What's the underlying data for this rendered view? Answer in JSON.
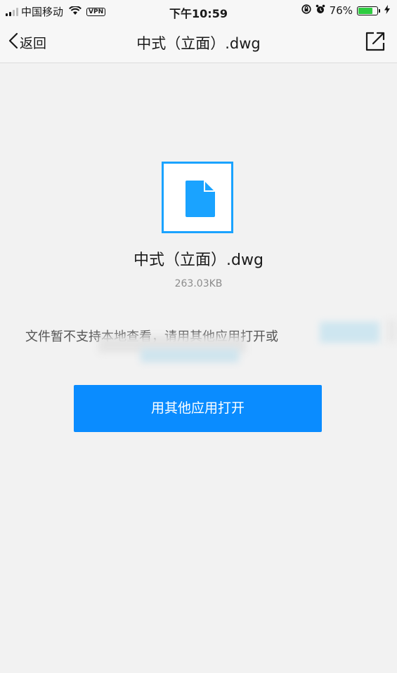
{
  "status_bar": {
    "carrier": "中国移动",
    "vpn": "VPN",
    "time": "下午10:59",
    "battery_percent": "76%",
    "battery_level": 0.76,
    "icons": [
      "signal-icon",
      "wifi-icon",
      "vpn-badge",
      "orientation-lock-icon",
      "alarm-icon",
      "battery-icon",
      "charging-icon"
    ]
  },
  "nav": {
    "back_label": "返回",
    "title": "中式（立面）.dwg",
    "icons": [
      "chevron-left-icon",
      "share-icon"
    ]
  },
  "file": {
    "icon": "file-icon",
    "name": "中式（立面）.dwg",
    "size": "263.03KB",
    "accent": "#1aa3ff"
  },
  "message": "文件暂不支持本地查看，请用其他应用打开或",
  "open_button": {
    "label": "用其他应用打开",
    "color": "#0a8cff"
  }
}
